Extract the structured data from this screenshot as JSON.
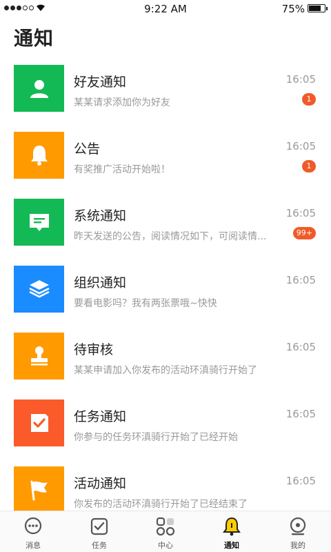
{
  "status": {
    "time": "9:22 AM",
    "battery": "75%",
    "battery_level": 0.75
  },
  "page": {
    "title": "通知"
  },
  "notifications": [
    {
      "title": "好友通知",
      "time": "16:05",
      "subtitle": "某某请求添加你为好友",
      "badge": "1",
      "icon": "user-icon",
      "color": "#13b955"
    },
    {
      "title": "公告",
      "time": "16:05",
      "subtitle": "有奖推广活动开始啦！",
      "badge": "1",
      "icon": "bell-icon",
      "color": "#ff9a00"
    },
    {
      "title": "系统通知",
      "time": "16:05",
      "subtitle": "昨天发送的公告，阅读情况如下，可阅读情...",
      "badge": "99+",
      "icon": "message-icon",
      "color": "#13b955"
    },
    {
      "title": "组织通知",
      "time": "16:05",
      "subtitle": "要看电影吗？我有两张票哦~快快",
      "badge": "",
      "icon": "layers-icon",
      "color": "#1a8cff"
    },
    {
      "title": "待审核",
      "time": "16:05",
      "subtitle": "某某申请加入你发布的活动环滇骑行开始了",
      "badge": "",
      "icon": "stamp-icon",
      "color": "#ff9a00"
    },
    {
      "title": "任务通知",
      "time": "16:05",
      "subtitle": "你参与的任务环滇骑行开始了已经开始",
      "badge": "",
      "icon": "task-check-icon",
      "color": "#fb5a2a"
    },
    {
      "title": "活动通知",
      "time": "16:05",
      "subtitle": "你发布的活动环滇骑行开始了已经结束了",
      "badge": "",
      "icon": "flag-icon",
      "color": "#ff9a00"
    }
  ],
  "tabs": [
    {
      "label": "消息",
      "icon": "chat-icon",
      "active": false
    },
    {
      "label": "任务",
      "icon": "task-icon",
      "active": false
    },
    {
      "label": "中心",
      "icon": "grid-icon",
      "active": false
    },
    {
      "label": "通知",
      "icon": "bell-icon",
      "active": true
    },
    {
      "label": "我的",
      "icon": "profile-icon",
      "active": false
    }
  ]
}
